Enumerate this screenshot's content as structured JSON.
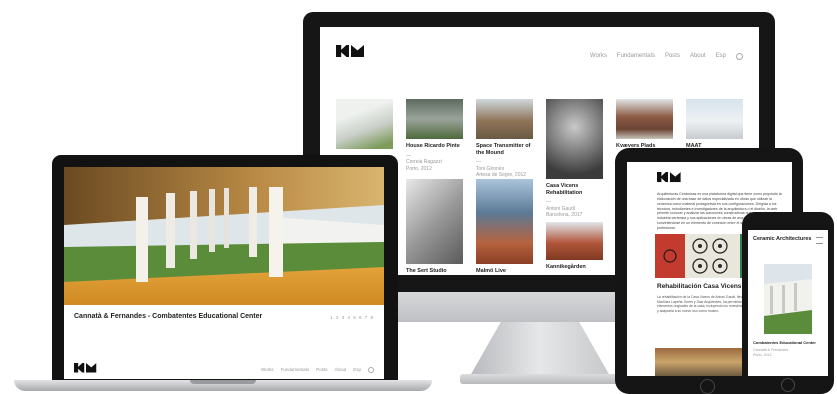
{
  "monitor": {
    "nav": [
      "Works",
      "Fundamentals",
      "Posts",
      "About",
      "Esp"
    ],
    "tiles": [
      {
        "title": "",
        "subtitle": ""
      },
      {
        "title": "House Ricardo Pinte",
        "subtitle": "—\nCorreia Ragazzi\nPorto, 2012"
      },
      {
        "title": "Space Transmitter of the Mound",
        "subtitle": "—\nToni Gironès\nArtesa de Segre, 2012"
      },
      {
        "title": "Casa Vicens Rehabilitation",
        "subtitle": "—\nAntoni Gaudí\nBarcelona, 2017"
      },
      {
        "title": "Kvævers Plads",
        "subtitle": ""
      },
      {
        "title": "MAAT",
        "subtitle": ""
      },
      {
        "title": "The Sert Studio",
        "subtitle": ""
      },
      {
        "title": "Malmö Live",
        "subtitle": ""
      },
      {
        "title": "Kannikegården",
        "subtitle": ""
      }
    ]
  },
  "laptop": {
    "caption": "Cannatà & Fernandes - Combatentes Educational Center",
    "pagination": "1 2 3 4 5 6 7 8",
    "nav": [
      "Works",
      "Fundamentals",
      "Posts",
      "About",
      "Esp"
    ]
  },
  "tablet": {
    "intro": "Arquitecturas Cerámicas es una plataforma digital que tiene como propósito la elaboración de una base de datos especializada en obras que utilizan la cerámica como material protagonista en sus configuraciones. Dirigida a los técnicos, estudiantes e investigadores de la arquitectura o el diseño, la web permite conocer y analizar las soluciones constructivas que proporcionan la industria cerámica y sus aplicaciones en obras de arquitectura de referencia, convirtiéndose en un elemento de conexión entre el sector productivo y profesional.",
    "post_title": "Rehabilitación Casa Vicens",
    "post_text": "La rehabilitación de la Casa Vicens de Antoni Gaudí, llevada a cabo por Martínez Lapeña-Torres y Daw Arquitectes, ha permitido recuperar los elementos originales de la casa, incluyendo los revestimientos cerámicos y adaptarla a su nuevo uso como museo."
  },
  "phone": {
    "title": "Ceramic Architectures",
    "caption_title": "Combatentes Educational Center",
    "caption_sub": "Cannatà & Fernandes\nPorto, 2012"
  }
}
